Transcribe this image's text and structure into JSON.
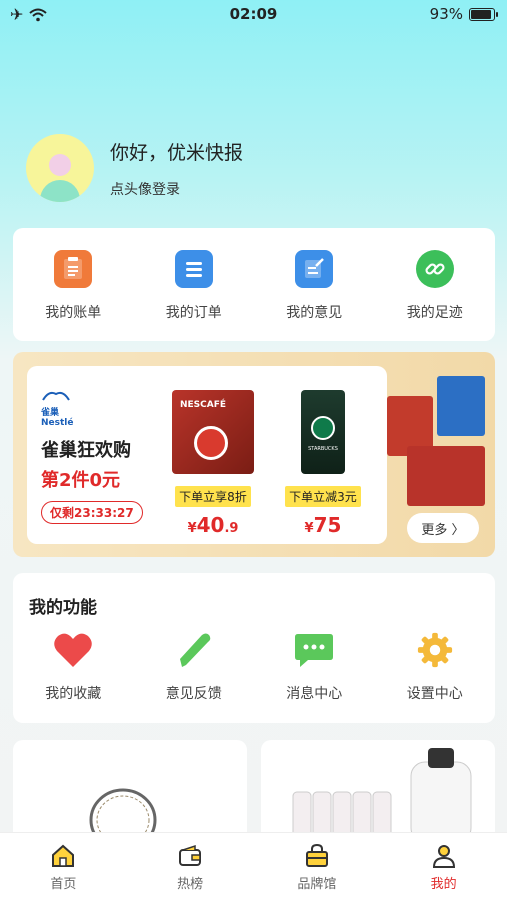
{
  "status": {
    "time": "02:09",
    "battery": "93%",
    "battery_level": 0.93
  },
  "profile": {
    "greeting": "你好，优米快报",
    "login_hint": "点头像登录"
  },
  "quick_actions": [
    {
      "label": "我的账单",
      "icon": "bill-icon",
      "color": "#f07a3a"
    },
    {
      "label": "我的订单",
      "icon": "order-list-icon",
      "color": "#3d8fe8"
    },
    {
      "label": "我的意见",
      "icon": "feedback-edit-icon",
      "color": "#3d8fe8"
    },
    {
      "label": "我的足迹",
      "icon": "link-icon",
      "color": "#3cbf5a"
    }
  ],
  "promo": {
    "brand": "雀巢 Nestlé",
    "title": "雀巢狂欢购",
    "subtitle": "第2件0元",
    "timer": "仅剩23:33:27",
    "products": [
      {
        "name": "NESCAFÉ",
        "tag": "下单立享8折",
        "currency": "¥",
        "price_main": "40",
        "price_decimal": ".9"
      },
      {
        "name": "STARBUCKS",
        "tag": "下单立减3元",
        "currency": "¥",
        "price_main": "75",
        "price_decimal": ""
      }
    ],
    "more": "更多 〉"
  },
  "functions": {
    "title": "我的功能",
    "items": [
      {
        "label": "我的收藏",
        "icon": "heart-icon",
        "color": "#ec4a4a"
      },
      {
        "label": "意见反馈",
        "icon": "pencil-icon",
        "color": "#5bc85b"
      },
      {
        "label": "消息中心",
        "icon": "message-icon",
        "color": "#5bc85b"
      },
      {
        "label": "设置中心",
        "icon": "gear-icon",
        "color": "#f4b93a"
      }
    ]
  },
  "tabs": [
    {
      "label": "首页",
      "icon": "home-icon",
      "active": false
    },
    {
      "label": "热榜",
      "icon": "wallet-icon",
      "active": false
    },
    {
      "label": "品牌馆",
      "icon": "shopping-bag-icon",
      "active": false
    },
    {
      "label": "我的",
      "icon": "user-icon",
      "active": true
    }
  ],
  "colors": {
    "accent": "#e02a2a",
    "tag_yellow": "#ffe24d"
  }
}
